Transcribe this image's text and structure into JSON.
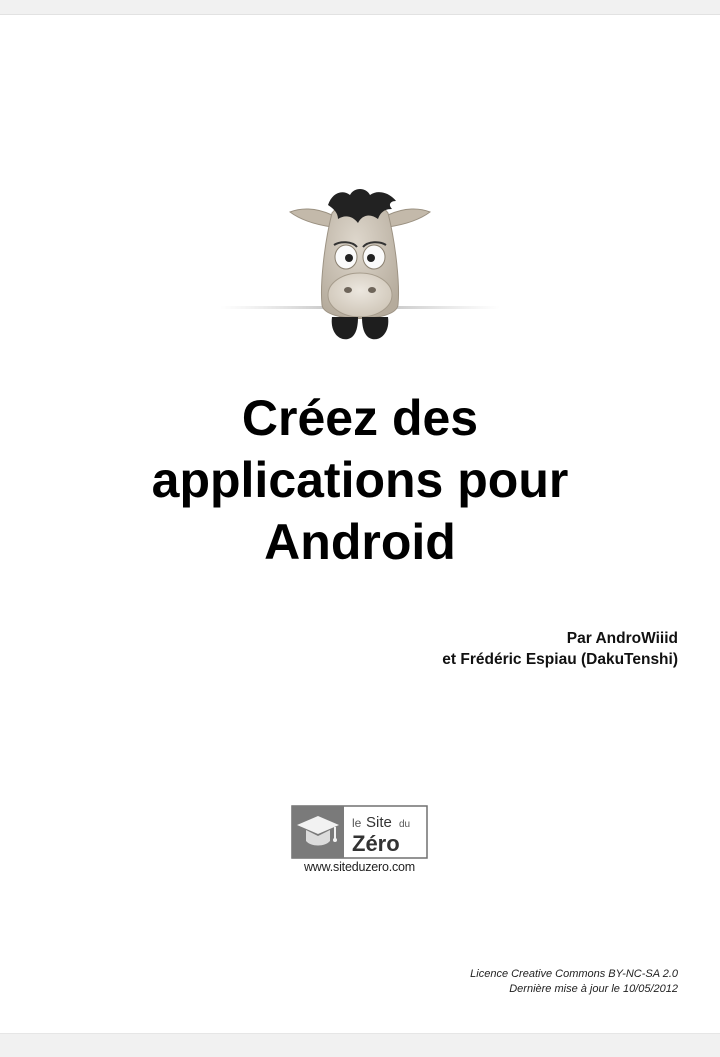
{
  "document": {
    "title_lines": [
      "Créez des",
      "applications pour",
      "Android"
    ],
    "authors": {
      "line1": "Par AndroWiiid",
      "line2": "et Frédéric Espiau (DakuTenshi)"
    },
    "logo": {
      "word_le": "le",
      "word_site": "Site",
      "word_du": "du",
      "word_zero": "Zéro",
      "url": "www.siteduzero.com"
    },
    "license": {
      "line1": "Licence Creative Commons BY-NC-SA 2.0",
      "line2": "Dernière mise à jour le 10/05/2012"
    },
    "colors": {
      "mascot_body": "#ccc4b8",
      "mascot_hair": "#222222",
      "logo_box": "#707070"
    },
    "icons": [
      "donkey-mascot-icon",
      "graduation-cap-icon"
    ]
  }
}
